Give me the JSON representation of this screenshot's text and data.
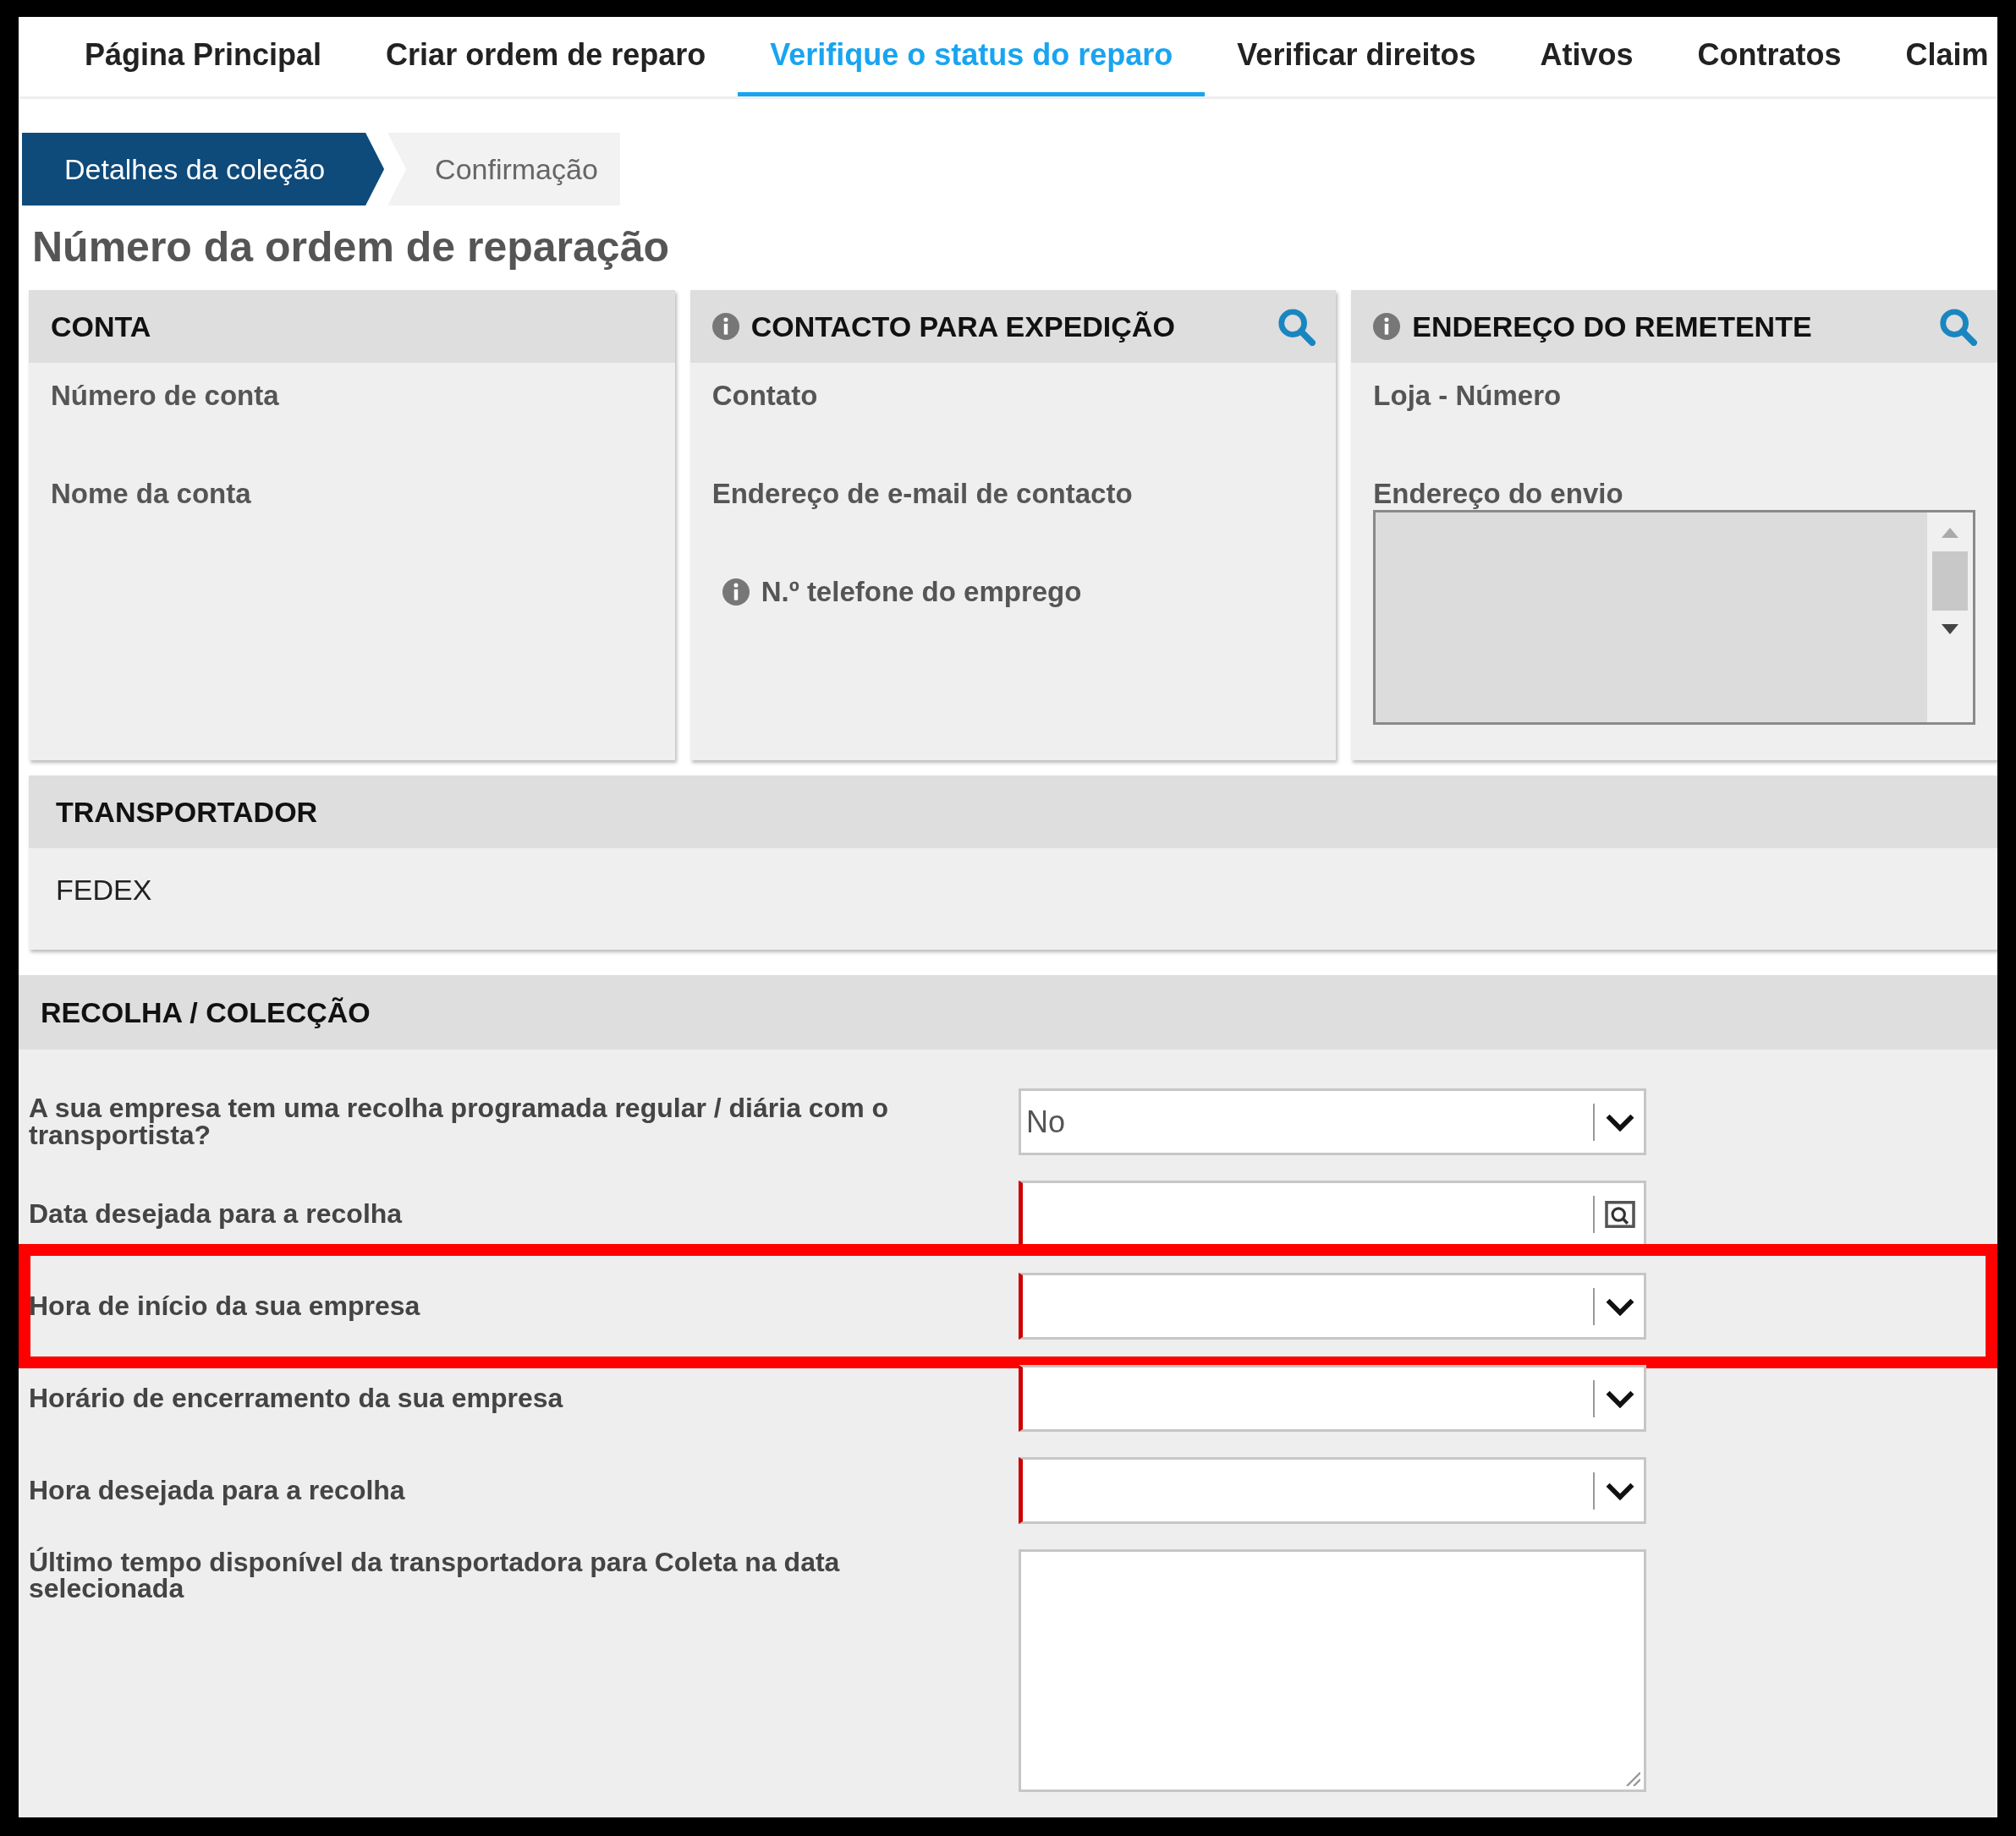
{
  "nav_tabs": [
    {
      "label": "Página Principal",
      "selected": false
    },
    {
      "label": "Criar ordem de reparo",
      "selected": false
    },
    {
      "label": "Verifique o status do reparo",
      "selected": true
    },
    {
      "label": "Verificar direitos",
      "selected": false
    },
    {
      "label": "Ativos",
      "selected": false
    },
    {
      "label": "Contratos",
      "selected": false
    },
    {
      "label": "Claim",
      "selected": false
    }
  ],
  "steps": [
    {
      "label": "Detalhes da coleção",
      "selected": true
    },
    {
      "label": "Confirmação",
      "selected": false
    }
  ],
  "page_title": "Número da ordem de reparação",
  "panels": [
    {
      "title": "CONTA",
      "info": false,
      "searchable": false,
      "fields": [
        {
          "label": "Número de conta",
          "info": false,
          "kind": "text"
        },
        {
          "label": "Nome da conta",
          "info": false,
          "kind": "text"
        }
      ]
    },
    {
      "title": "CONTACTO PARA EXPEDIÇÃO",
      "info": true,
      "searchable": true,
      "fields": [
        {
          "label": "Contato",
          "info": false,
          "kind": "text"
        },
        {
          "label": "Endereço de e-mail de contacto",
          "info": false,
          "kind": "text"
        },
        {
          "label": "N.º telefone do emprego",
          "info": true,
          "kind": "text"
        }
      ]
    },
    {
      "title": "ENDEREÇO DO REMETENTE",
      "info": true,
      "searchable": true,
      "fields": [
        {
          "label": "Loja - Número",
          "info": false,
          "kind": "text"
        },
        {
          "label": "Endereço do envio",
          "info": false,
          "kind": "textarea"
        }
      ]
    }
  ],
  "carrier": {
    "title": "TRANSPORTADOR",
    "value": "FEDEX"
  },
  "collection": {
    "title": "RECOLHA / COLECÇÃO",
    "rows": [
      {
        "label": "A sua empresa tem uma recolha programada regular / diária com o transportista?",
        "kind": "select",
        "value": "No",
        "required": false,
        "highlighted": false
      },
      {
        "label": "Data desejada para a recolha",
        "kind": "date",
        "required": true,
        "highlighted": false
      },
      {
        "label": "Hora de início da sua empresa",
        "kind": "select",
        "required": true,
        "highlighted": true
      },
      {
        "label": "Horário de encerramento da sua empresa",
        "kind": "select",
        "required": true,
        "highlighted": false
      },
      {
        "label": "Hora desejada para a recolha",
        "kind": "select",
        "required": true,
        "highlighted": false
      },
      {
        "label": "Último tempo disponível da transportadora para Coleta na data selecionada",
        "kind": "textarea",
        "required": false,
        "highlighted": false
      }
    ]
  }
}
